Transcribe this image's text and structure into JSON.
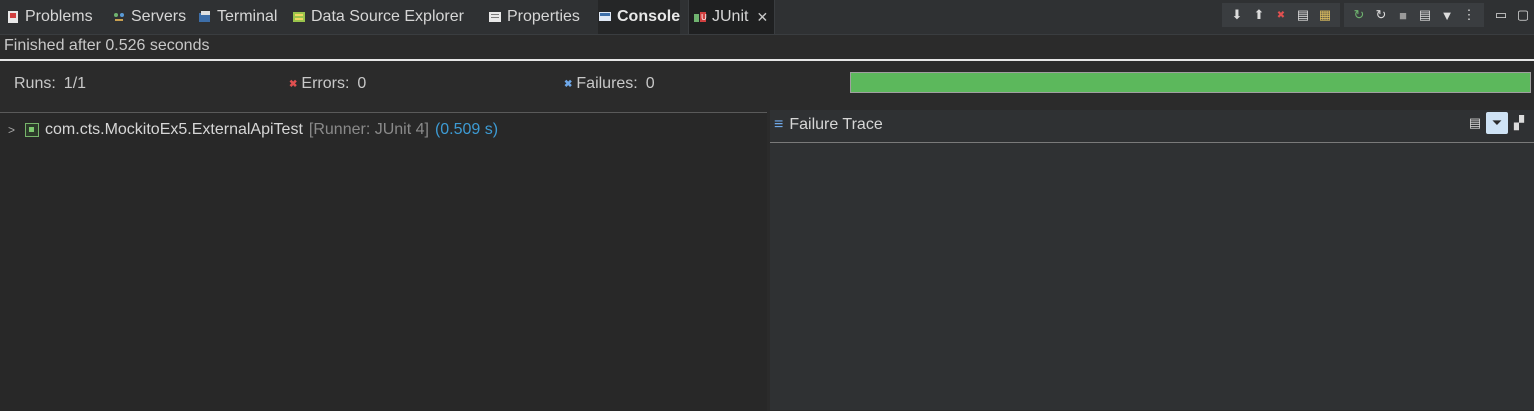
{
  "tabs": [
    {
      "label": "Problems",
      "icon": "problems-icon"
    },
    {
      "label": "Servers",
      "icon": "servers-icon"
    },
    {
      "label": "Terminal",
      "icon": "terminal-icon"
    },
    {
      "label": "Data Source Explorer",
      "icon": "data-source-icon"
    },
    {
      "label": "Properties",
      "icon": "properties-icon"
    },
    {
      "label": "Console",
      "icon": "console-icon"
    },
    {
      "label": "JUnit",
      "icon": "junit-icon"
    }
  ],
  "status": "Finished after 0.526 seconds",
  "counters": {
    "runs_label": "Runs:",
    "runs_value": "1/1",
    "errors_label": "Errors:",
    "errors_value": "0",
    "failures_label": "Failures:",
    "failures_value": "0"
  },
  "progress": {
    "fraction": 1.0,
    "color": "#5cb85c"
  },
  "tree": {
    "test_class": "com.cts.MockitoEx5.ExternalApiTest",
    "runner": "[Runner: JUnit 4]",
    "time": "(0.509 s)"
  },
  "failure_trace": {
    "title": "Failure Trace"
  },
  "toolbar_icons": [
    "next-failure-icon",
    "previous-failure-icon",
    "failures-only-icon",
    "scroll-lock-icon",
    "layout-icon",
    "rerun-icon",
    "rerun-failed-icon",
    "stop-icon",
    "history-icon",
    "view-menu-icon",
    "more-icon",
    "minimize-icon",
    "maximize-icon"
  ]
}
